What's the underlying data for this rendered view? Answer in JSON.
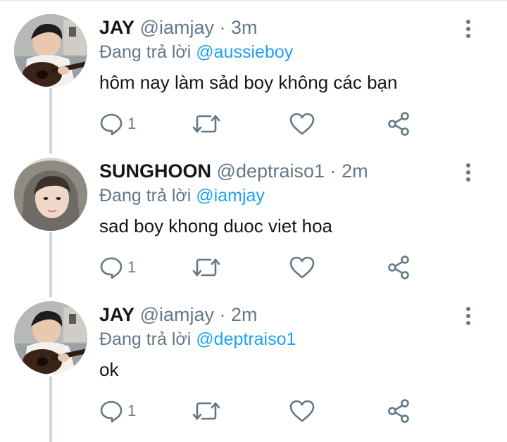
{
  "tweets": [
    {
      "name": "JAY",
      "handle": "@iamjay",
      "dot": "·",
      "time": "3m",
      "reply_prefix": "Đang trả lời",
      "reply_to": "@aussieboy",
      "text": "hôm nay làm sảd boy không các bạn",
      "reply_count": "1",
      "avatar_icon": "profile-photo-guitar"
    },
    {
      "name": "SUNGHOON",
      "handle": "@deptraiso1",
      "dot": "·",
      "time": "2m",
      "reply_prefix": "Đang trả lời",
      "reply_to": "@iamjay",
      "text": "sad boy khong duoc viet hoa",
      "reply_count": "1",
      "avatar_icon": "profile-photo-hood"
    },
    {
      "name": "JAY",
      "handle": "@iamjay",
      "dot": "·",
      "time": "2m",
      "reply_prefix": "Đang trả lời",
      "reply_to": "@deptraiso1",
      "text": "ok",
      "reply_count": "1",
      "avatar_icon": "profile-photo-guitar"
    }
  ],
  "colors": {
    "text": "#14171a",
    "secondary": "#657786",
    "mention": "#1da1f2",
    "thread_line": "#ccd6dd"
  },
  "icons": {
    "reply": "reply-icon",
    "retweet": "retweet-icon",
    "like": "heart-icon",
    "share": "share-icon",
    "more": "more-vertical-icon"
  }
}
